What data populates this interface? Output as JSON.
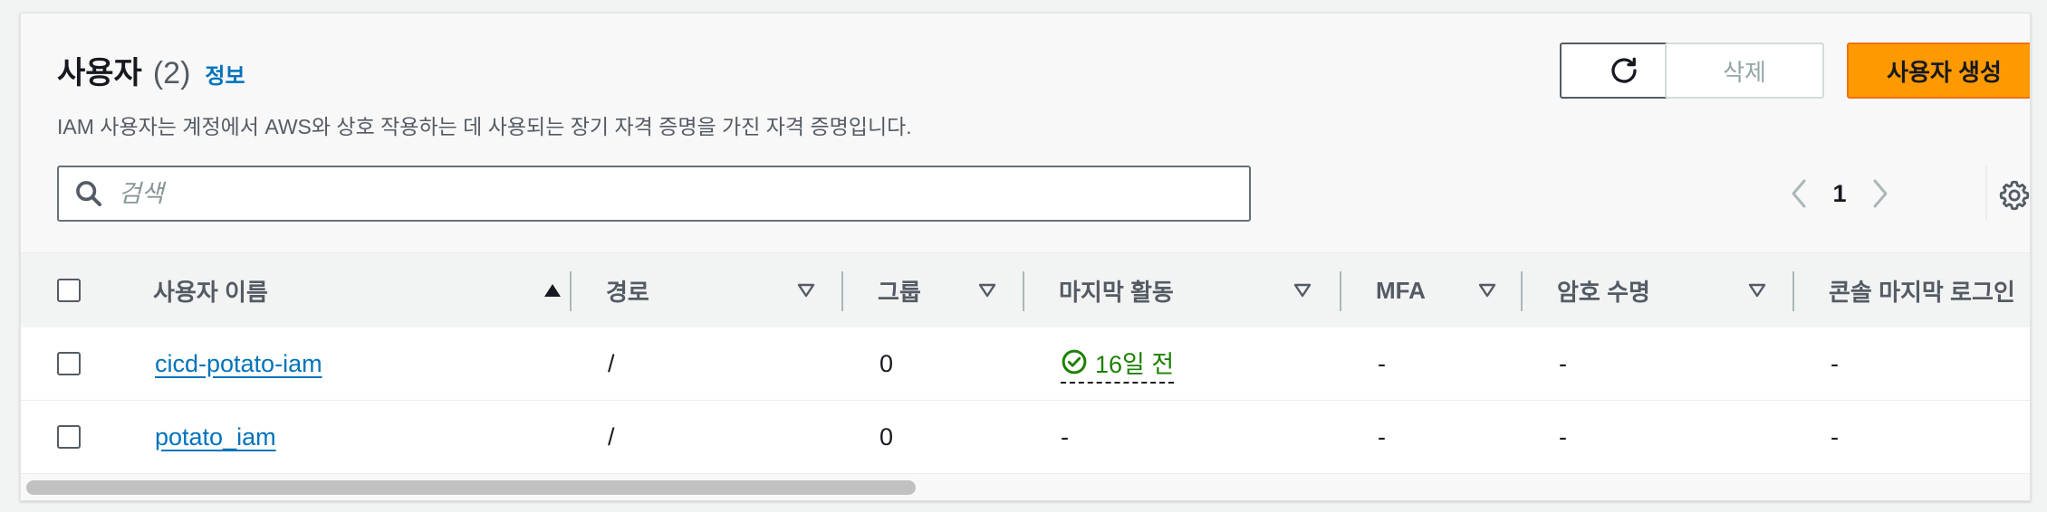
{
  "header": {
    "title": "사용자",
    "count": "(2)",
    "info_link": "정보",
    "description": "IAM 사용자는 계정에서 AWS와 상호 작용하는 데 사용되는 장기 자격 증명을 가진 자격 증명입니다."
  },
  "toolbar": {
    "refresh_icon": "refresh-icon",
    "delete_label": "삭제",
    "create_label": "사용자 생성"
  },
  "search": {
    "placeholder": "검색",
    "value": ""
  },
  "pagination": {
    "current_page": "1"
  },
  "colors": {
    "accent": "#ff9900",
    "link": "#0073bb",
    "success": "#1d8102"
  },
  "table": {
    "columns": [
      "사용자 이름",
      "경로",
      "그룹",
      "마지막 활동",
      "MFA",
      "암호 수명",
      "콘솔 마지막 로그인"
    ],
    "sorted_column": "사용자 이름",
    "rows": [
      {
        "name": "cicd-potato-iam",
        "path": "/",
        "groups": "0",
        "last_activity": "16일 전",
        "mfa": "-",
        "password_age": "-",
        "console_last_login": "-"
      },
      {
        "name": "potato_iam",
        "path": "/",
        "groups": "0",
        "last_activity": "-",
        "mfa": "-",
        "password_age": "-",
        "console_last_login": "-"
      }
    ]
  }
}
